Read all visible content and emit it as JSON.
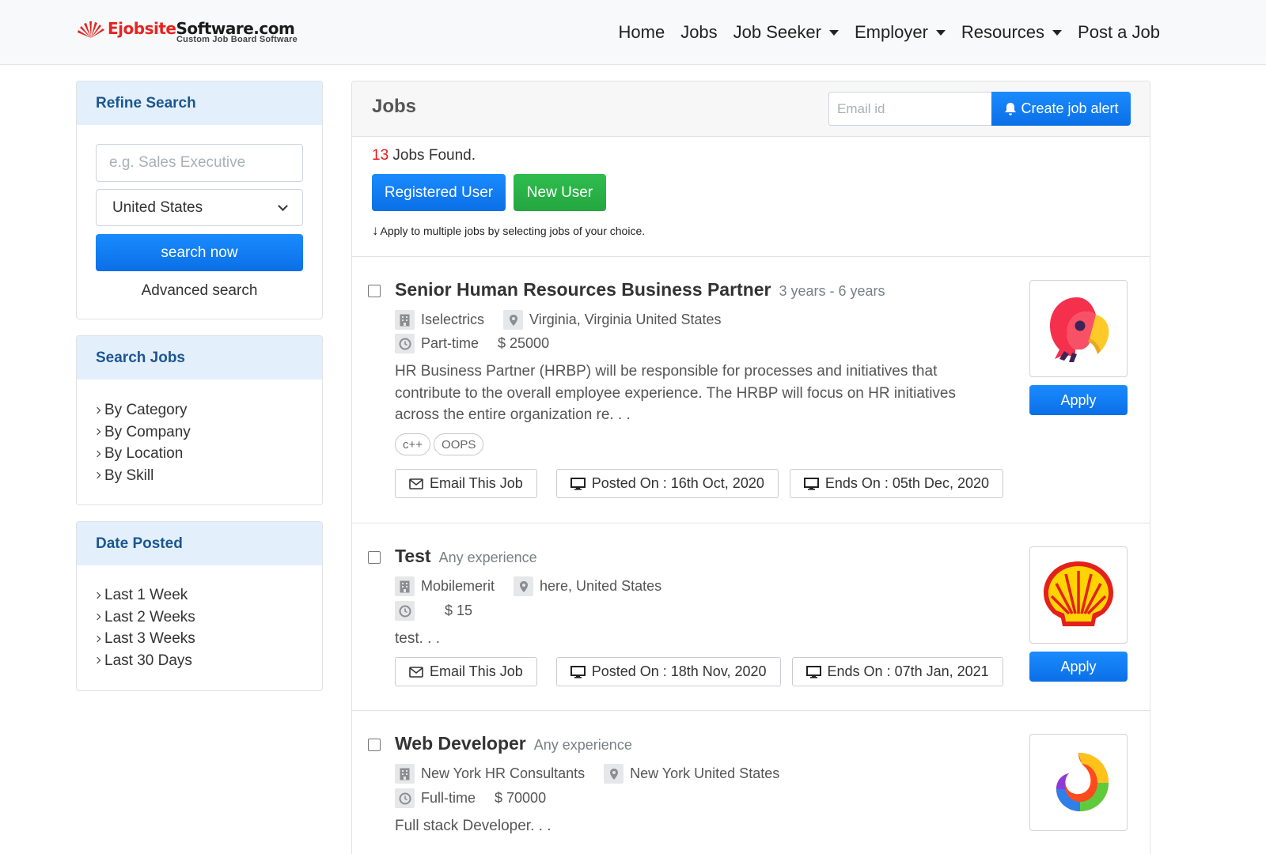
{
  "brand": {
    "name_red": "Ejobsite",
    "name_dark": "Software.com",
    "tagline": "Custom Job Board Software"
  },
  "nav": {
    "items": [
      {
        "label": "Home",
        "dropdown": false
      },
      {
        "label": "Jobs",
        "dropdown": false
      },
      {
        "label": "Job Seeker",
        "dropdown": true
      },
      {
        "label": "Employer",
        "dropdown": true
      },
      {
        "label": "Resources",
        "dropdown": true
      },
      {
        "label": "Post a Job",
        "dropdown": false
      }
    ]
  },
  "refine": {
    "title": "Refine Search",
    "keyword_placeholder": "e.g. Sales Executive",
    "country_selected": "United States",
    "search_label": "search now",
    "advanced_label": "Advanced search"
  },
  "search_jobs": {
    "title": "Search Jobs",
    "links": [
      "By Category",
      "By Company",
      "By Location",
      "By Skill"
    ]
  },
  "date_posted": {
    "title": "Date Posted",
    "links": [
      "Last 1 Week",
      "Last 2 Weeks",
      "Last 3 Weeks",
      "Last 30 Days"
    ]
  },
  "jobs_panel": {
    "title": "Jobs",
    "email_placeholder": "Email id",
    "alert_label": "Create job alert",
    "found_count": "13",
    "found_text": " Jobs Found.",
    "registered_label": "Registered User",
    "new_user_label": "New User",
    "hint": "Apply to multiple jobs by selecting jobs of your choice."
  },
  "jobs": [
    {
      "title": "Senior Human Resources Business Partner",
      "experience": "3 years - 6 years",
      "company": "Iselectrics",
      "location": "Virginia, Virginia United States",
      "type": "Part-time",
      "salary": "$ 25000",
      "description": "HR Business Partner (HRBP) will be responsible for processes and initiatives that contribute to the overall employee experience. The HRBP will focus on HR initiatives across the entire organization re. . .",
      "tags": [
        "c++",
        "OOPS"
      ],
      "email_label": "Email This Job",
      "posted": "Posted On : 16th Oct, 2020",
      "ends": "Ends On : 05th Dec, 2020",
      "apply_label": "Apply",
      "logo": "parrot-logo"
    },
    {
      "title": "Test",
      "experience": "Any experience",
      "company": "Mobilemerit",
      "location": "here, United States",
      "type": "",
      "salary": "$ 15",
      "description": "test. . .",
      "tags": [],
      "email_label": "Email This Job",
      "posted": "Posted On : 18th Nov, 2020",
      "ends": "Ends On : 07th Jan, 2021",
      "apply_label": "Apply",
      "logo": "shell-logo"
    },
    {
      "title": "Web Developer",
      "experience": "Any experience",
      "company": "New York HR Consultants",
      "location": "New York United States",
      "type": "Full-time",
      "salary": "$ 70000",
      "description": "Full stack Developer. . .",
      "tags": [],
      "logo": "swirl-logo"
    }
  ],
  "colors": {
    "primary": "#0d74ec",
    "success": "#28a745",
    "card_header": "#e3f0fc",
    "header_text": "#1d5690",
    "count_red": "#e21c1c"
  }
}
